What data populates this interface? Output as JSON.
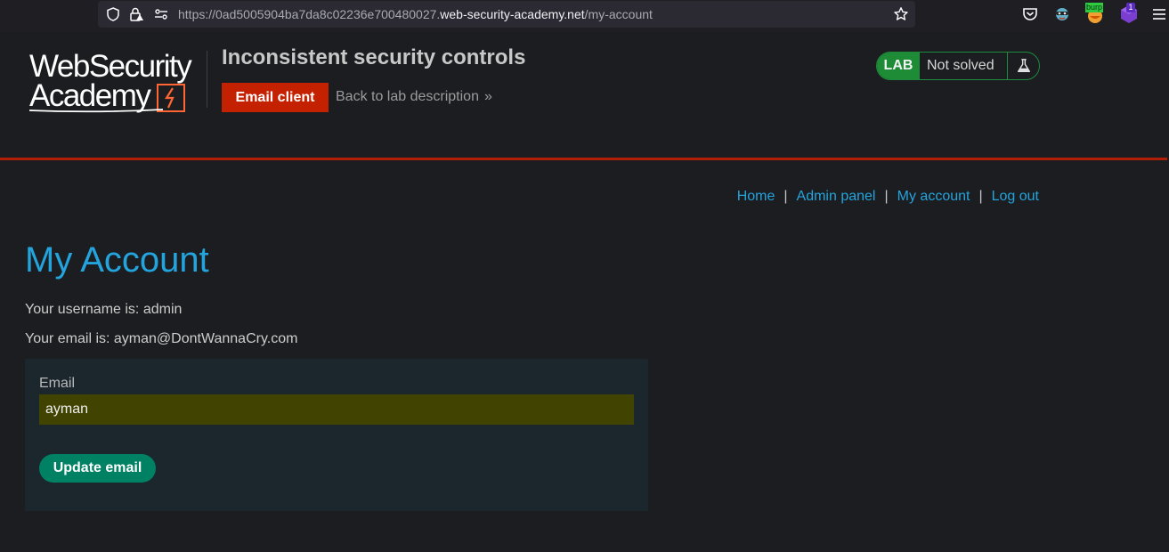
{
  "browser": {
    "url_prefix": "https://0ad5005904ba7da8c02236e700480027.",
    "url_domain": "web-security-academy.net",
    "url_path": "/my-account",
    "extension_badge_text": "burp",
    "notification_count": "1"
  },
  "header": {
    "logo_line1": "WebSecurity",
    "logo_line2": "Academy",
    "lab_title": "Inconsistent security controls",
    "email_client_label": "Email client",
    "back_link_label": "Back to lab description",
    "back_link_chevron": "»",
    "lab_badge": "LAB",
    "lab_status": "Not solved",
    "status_color": "#1e8b36",
    "accent_color": "#c42101"
  },
  "nav": {
    "items": [
      "Home",
      "Admin panel",
      "My account",
      "Log out"
    ],
    "separator": "|"
  },
  "main": {
    "title": "My Account",
    "username_line": "Your username is: admin",
    "email_line": "Your email is: ayman@DontWannaCry.com",
    "form": {
      "email_label": "Email",
      "email_value": "ayman",
      "submit_label": "Update email"
    }
  }
}
